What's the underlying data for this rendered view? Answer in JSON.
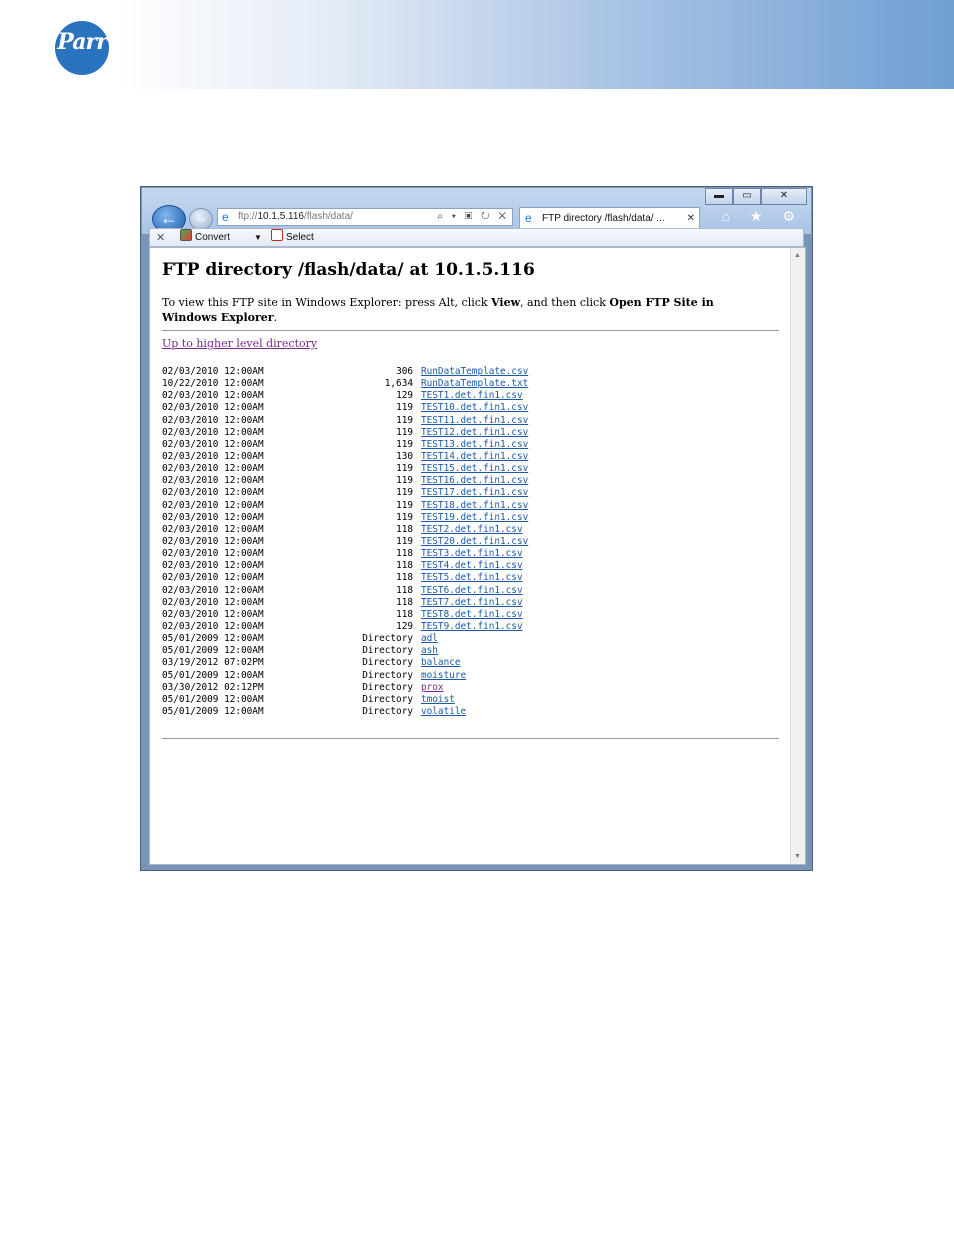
{
  "brand": {
    "logo_text": "Parr"
  },
  "browser": {
    "window_controls": {
      "minimize": "▬",
      "maximize": "▭",
      "close": "✕"
    },
    "address": {
      "prefix": "ftp://",
      "host": "10.1.5.116",
      "path": "/flash/data/",
      "tools": "⌕ ▾ ▣ ↻ ✕"
    },
    "tab": {
      "title": "FTP directory /flash/data/ ...",
      "close": "✕"
    },
    "right_icons": "⌂ ★ ⚙",
    "command_bar": {
      "close": "✕",
      "convert_label": "Convert",
      "select_label": "Select"
    }
  },
  "page": {
    "heading": "FTP directory /flash/data/ at 10.1.5.116",
    "intro_1": "To view this FTP site in Windows Explorer: press Alt, click ",
    "intro_view": "View",
    "intro_2": ", and then click ",
    "intro_open": "Open FTP Site in Windows Explorer",
    "intro_end": ".",
    "up_link": "Up to higher level directory"
  },
  "listing": [
    {
      "date": "02/03/2010 12:00AM",
      "size": "306",
      "name": "RunDataTemplate.csv"
    },
    {
      "date": "10/22/2010 12:00AM",
      "size": "1,634",
      "name": "RunDataTemplate.txt"
    },
    {
      "date": "02/03/2010 12:00AM",
      "size": "129",
      "name": "TEST1.det.fin1.csv"
    },
    {
      "date": "02/03/2010 12:00AM",
      "size": "119",
      "name": "TEST10.det.fin1.csv"
    },
    {
      "date": "02/03/2010 12:00AM",
      "size": "119",
      "name": "TEST11.det.fin1.csv"
    },
    {
      "date": "02/03/2010 12:00AM",
      "size": "119",
      "name": "TEST12.det.fin1.csv"
    },
    {
      "date": "02/03/2010 12:00AM",
      "size": "119",
      "name": "TEST13.det.fin1.csv"
    },
    {
      "date": "02/03/2010 12:00AM",
      "size": "130",
      "name": "TEST14.det.fin1.csv"
    },
    {
      "date": "02/03/2010 12:00AM",
      "size": "119",
      "name": "TEST15.det.fin1.csv"
    },
    {
      "date": "02/03/2010 12:00AM",
      "size": "119",
      "name": "TEST16.det.fin1.csv"
    },
    {
      "date": "02/03/2010 12:00AM",
      "size": "119",
      "name": "TEST17.det.fin1.csv"
    },
    {
      "date": "02/03/2010 12:00AM",
      "size": "119",
      "name": "TEST18.det.fin1.csv"
    },
    {
      "date": "02/03/2010 12:00AM",
      "size": "119",
      "name": "TEST19.det.fin1.csv"
    },
    {
      "date": "02/03/2010 12:00AM",
      "size": "118",
      "name": "TEST2.det.fin1.csv"
    },
    {
      "date": "02/03/2010 12:00AM",
      "size": "119",
      "name": "TEST20.det.fin1.csv"
    },
    {
      "date": "02/03/2010 12:00AM",
      "size": "118",
      "name": "TEST3.det.fin1.csv"
    },
    {
      "date": "02/03/2010 12:00AM",
      "size": "118",
      "name": "TEST4.det.fin1.csv"
    },
    {
      "date": "02/03/2010 12:00AM",
      "size": "118",
      "name": "TEST5.det.fin1.csv"
    },
    {
      "date": "02/03/2010 12:00AM",
      "size": "118",
      "name": "TEST6.det.fin1.csv"
    },
    {
      "date": "02/03/2010 12:00AM",
      "size": "118",
      "name": "TEST7.det.fin1.csv"
    },
    {
      "date": "02/03/2010 12:00AM",
      "size": "118",
      "name": "TEST8.det.fin1.csv"
    },
    {
      "date": "02/03/2010 12:00AM",
      "size": "129",
      "name": "TEST9.det.fin1.csv"
    },
    {
      "date": "05/01/2009 12:00AM",
      "size": "Directory",
      "name": "adl"
    },
    {
      "date": "05/01/2009 12:00AM",
      "size": "Directory",
      "name": "ash"
    },
    {
      "date": "03/19/2012 07:02PM",
      "size": "Directory",
      "name": "balance"
    },
    {
      "date": "05/01/2009 12:00AM",
      "size": "Directory",
      "name": "moisture"
    },
    {
      "date": "03/30/2012 02:12PM",
      "size": "Directory",
      "name": "prox",
      "visited": true
    },
    {
      "date": "05/01/2009 12:00AM",
      "size": "Directory",
      "name": "tmoist"
    },
    {
      "date": "05/01/2009 12:00AM",
      "size": "Directory",
      "name": "volatile"
    }
  ]
}
